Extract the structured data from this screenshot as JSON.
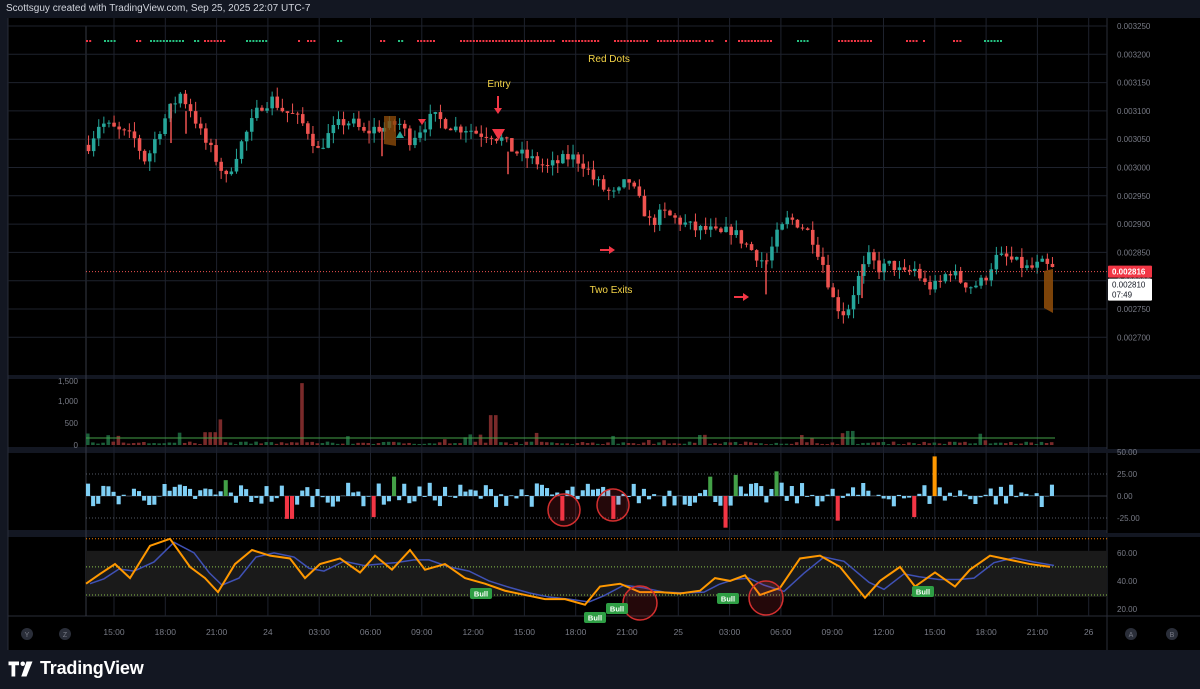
{
  "header": {
    "credit": "Scottsguy created with TradingView.com, Sep 25, 2025 22:07 UTC-7"
  },
  "footer": {
    "brand": "TradingView"
  },
  "colors": {
    "up": "#26a69a",
    "down": "#ef5350",
    "grid": "#1e222d",
    "pane_bg": "#000000",
    "annotation": "#f5d547",
    "arrow": "#f23645",
    "hist_pos": "#7fcff5",
    "hist_green": "#43a047",
    "hist_red": "#f23645",
    "hist_orange": "#ff9800",
    "k_line": "#ff9800",
    "d_line": "#3f51b5",
    "bull_label": "#2e9e44",
    "price_last_bg": "#f23645"
  },
  "price_axis": {
    "ticks": [
      "0.003250",
      "0.003200",
      "0.003150",
      "0.003100",
      "0.003050",
      "0.003000",
      "0.002950",
      "0.002900",
      "0.002850",
      "0.002800",
      "0.002750",
      "0.002700"
    ],
    "last_price": "0.002816",
    "current_price": "0.002810",
    "countdown": "07:49"
  },
  "volume_axis": {
    "ticks": [
      "1,500",
      "1,000",
      "500",
      "0"
    ]
  },
  "osc_axis": {
    "ticks": [
      "50.00",
      "25.00",
      "0.00",
      "-25.00"
    ]
  },
  "stoch_axis": {
    "ticks": [
      "60.00",
      "40.00",
      "20.00"
    ]
  },
  "time_axis": {
    "ticks": [
      "15:00",
      "18:00",
      "21:00",
      "24",
      "03:00",
      "06:00",
      "09:00",
      "12:00",
      "15:00",
      "18:00",
      "21:00",
      "25",
      "03:00",
      "06:00",
      "09:00",
      "12:00",
      "15:00",
      "18:00",
      "21:00",
      "26"
    ]
  },
  "axis_buttons": {
    "left_1": "Y",
    "left_2": "Z",
    "right_1": "A",
    "right_2": "B"
  },
  "annotations": {
    "red_dots": "Red Dots",
    "entry": "Entry",
    "two_exits": "Two Exits",
    "bull": "Bull"
  },
  "chart_data": {
    "type": "candlestick",
    "title": "",
    "y_range": [
      0.00268,
      0.00326
    ],
    "time_range": [
      "Sep 23 13:00",
      "Sep 26 03:00"
    ],
    "price_path": [
      [
        0.00304,
        0.00308,
        0.00307,
        0.00306,
        0.00305,
        0.00301,
        0.00306,
        0.0031,
        0.00313,
        0.0031,
        0.00305,
        0.00302,
        0.00298,
        0.00303,
        0.00307,
        0.00311,
        0.00312,
        0.0031,
        0.00309,
        0.00307,
        0.00303,
        0.00306,
        0.00308,
        0.00308,
        0.00306,
        0.00307,
        0.00307,
        0.00308,
        0.00305,
        0.00307,
        0.00309,
        0.00308,
        0.00307,
        0.00307,
        0.00306,
        0.00306,
        0.00305,
        0.00303,
        0.00302,
        0.00301,
        0.003,
        0.00301,
        0.00302,
        0.00301,
        0.00298,
        0.00296,
        0.00295,
        0.00298,
        0.00294,
        0.0029,
        0.00292,
        0.00291,
        0.0029,
        0.00289,
        0.00289,
        0.00288,
        0.00289,
        0.00287,
        0.00285,
        0.00283,
        0.00288,
        0.00291,
        0.0029,
        0.00288,
        0.00283,
        0.00276,
        0.00274,
        0.0028,
        0.00284,
        0.00282,
        0.00283,
        0.00281,
        0.00282,
        0.00279,
        0.00279,
        0.00282,
        0.0028,
        0.00279,
        0.0028,
        0.00284,
        0.00284,
        0.00283,
        0.00282,
        0.00283,
        0.00282
      ]
    ],
    "volume_range": [
      0,
      1500
    ],
    "volume_spikes": [
      {
        "time": "Sep 24 01:30",
        "value": 1450
      },
      {
        "time": "Sep 23 20:00",
        "value": 600
      },
      {
        "time": "Sep 24 13:00",
        "value": 700
      },
      {
        "time": "Sep 25 09:00",
        "value": 400
      }
    ],
    "oscillator_range": [
      -40,
      50
    ],
    "oscillator_levels": [
      25,
      -25
    ],
    "stoch_range": [
      15,
      72
    ],
    "stoch_levels": [
      50,
      30
    ],
    "signal_dots": "red and green dot clusters along the top of the price pane"
  }
}
